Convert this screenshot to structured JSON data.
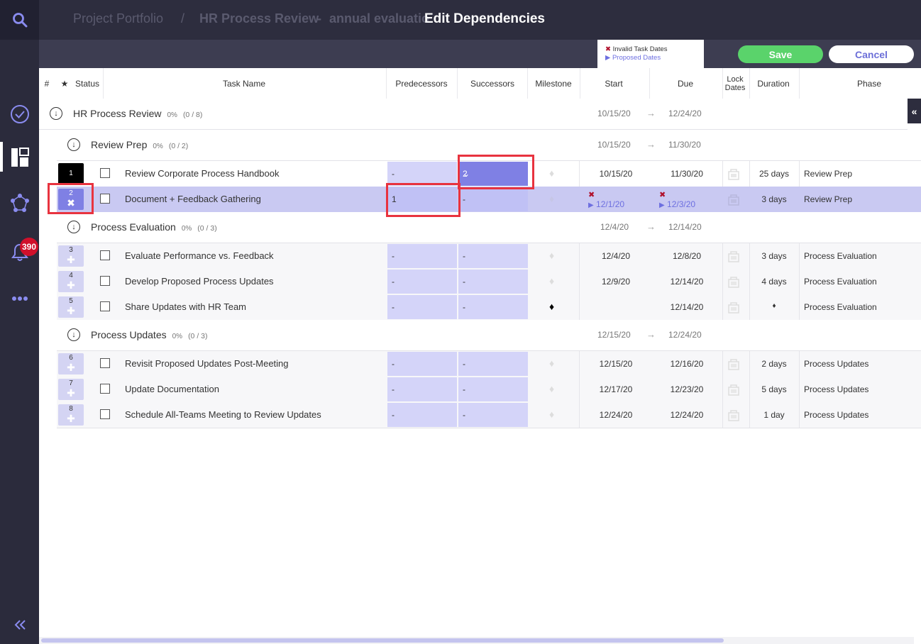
{
  "breadcrumb": {
    "portfolio": "Project Portfolio",
    "separator": "/",
    "project": "HR Process Review",
    "dash": "-",
    "project_suffix": "annual evaluatio"
  },
  "dialog": {
    "title": "Edit Dependencies",
    "legend_invalid": "Invalid Task Dates",
    "legend_proposed": "Proposed Dates",
    "save_label": "Save",
    "cancel_label": "Cancel"
  },
  "sidebar": {
    "notification_count": "390"
  },
  "columns": {
    "num": "#",
    "star": "★",
    "status": "Status",
    "task_name": "Task Name",
    "predecessors": "Predecessors",
    "successors": "Successors",
    "milestone": "Milestone",
    "start": "Start",
    "due": "Due",
    "lock_dates_1": "Lock",
    "lock_dates_2": "Dates",
    "duration": "Duration",
    "phase": "Phase"
  },
  "project": {
    "name": "HR Process Review",
    "pct": "0%",
    "count": "(0 / 8)",
    "start": "10/15/20",
    "arrow": "→",
    "due": "12/24/20"
  },
  "phases": [
    {
      "name": "Review Prep",
      "pct": "0%",
      "count": "(0 / 2)",
      "start": "10/15/20",
      "arrow": "→",
      "due": "11/30/20"
    },
    {
      "name": "Process Evaluation",
      "pct": "0%",
      "count": "(0 / 3)",
      "start": "12/4/20",
      "arrow": "→",
      "due": "12/14/20"
    },
    {
      "name": "Process Updates",
      "pct": "0%",
      "count": "(0 / 3)",
      "start": "12/15/20",
      "arrow": "→",
      "due": "12/24/20"
    }
  ],
  "tasks": [
    {
      "num": "1",
      "name": "Review Corporate Process Handbook",
      "pred": "-",
      "succ": "2",
      "start": "10/15/20",
      "due": "11/30/20",
      "duration": "25 days",
      "phase": "Review Prep"
    },
    {
      "num": "2",
      "name": "Document + Feedback Gathering",
      "pred": "1",
      "succ": "-",
      "start": "12/1/20",
      "due": "12/3/20",
      "duration": "3 days",
      "phase": "Review Prep",
      "invalid_mark": "✖",
      "proposed_mark": "▶"
    },
    {
      "num": "3",
      "name": "Evaluate Performance vs. Feedback",
      "pred": "-",
      "succ": "-",
      "start": "12/4/20",
      "due": "12/8/20",
      "duration": "3 days",
      "phase": "Process Evaluation"
    },
    {
      "num": "4",
      "name": "Develop Proposed Process Updates",
      "pred": "-",
      "succ": "-",
      "start": "12/9/20",
      "due": "12/14/20",
      "duration": "4 days",
      "phase": "Process Evaluation"
    },
    {
      "num": "5",
      "name": "Share Updates with HR Team",
      "pred": "-",
      "succ": "-",
      "start": "",
      "due": "12/14/20",
      "duration": "♦",
      "phase": "Process Evaluation"
    },
    {
      "num": "6",
      "name": "Revisit Proposed Updates Post-Meeting",
      "pred": "-",
      "succ": "-",
      "start": "12/15/20",
      "due": "12/16/20",
      "duration": "2 days",
      "phase": "Process Updates"
    },
    {
      "num": "7",
      "name": "Update Documentation",
      "pred": "-",
      "succ": "-",
      "start": "12/17/20",
      "due": "12/23/20",
      "duration": "5 days",
      "phase": "Process Updates"
    },
    {
      "num": "8",
      "name": "Schedule All-Teams Meeting to Review Updates",
      "pred": "-",
      "succ": "-",
      "start": "12/24/20",
      "due": "12/24/20",
      "duration": "1 day",
      "phase": "Process Updates"
    }
  ],
  "colors": {
    "accent": "#7f80e4",
    "save": "#5ad36b",
    "highlight": "#e8333f",
    "badge": "#d0102b"
  }
}
